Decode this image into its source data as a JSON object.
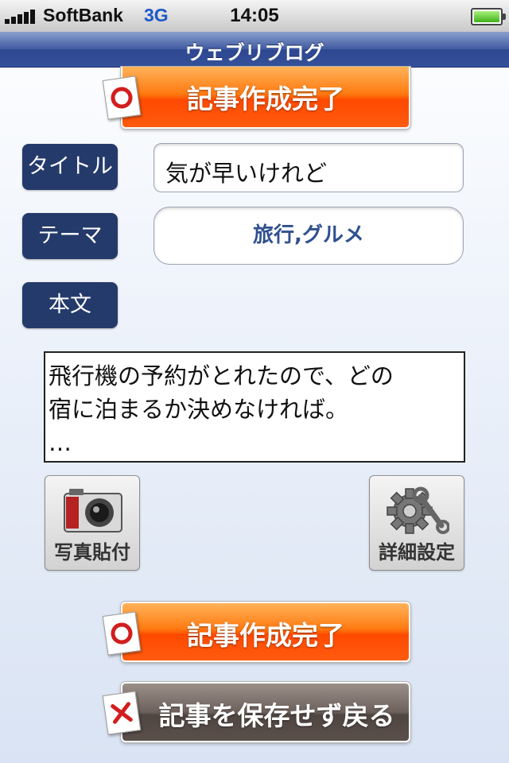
{
  "status_bar": {
    "carrier": "SoftBank",
    "network": "3G",
    "time": "14:05",
    "battery_level": 1.0
  },
  "nav": {
    "title": "ウェブリブログ"
  },
  "actions": {
    "complete_top": "記事作成完了",
    "complete_bottom": "記事作成完了",
    "discard": "記事を保存せず戻る"
  },
  "form": {
    "title_label": "タイトル",
    "title_value": "気が早いけれど",
    "theme_label": "テーマ",
    "theme_value": "旅行,グルメ",
    "body_label": "本文",
    "body_value": "飛行機の予約がとれたので、どの\n宿に泊まるか決めなければ。\n…"
  },
  "tools": {
    "photo_label": "写真貼付",
    "settings_label": "詳細設定"
  },
  "colors": {
    "nav_bar": "#35519a",
    "label_bg": "#243a6a",
    "complete_button": "#ff5a00",
    "discard_button": "#5a4f4b",
    "theme_text": "#30508f"
  }
}
